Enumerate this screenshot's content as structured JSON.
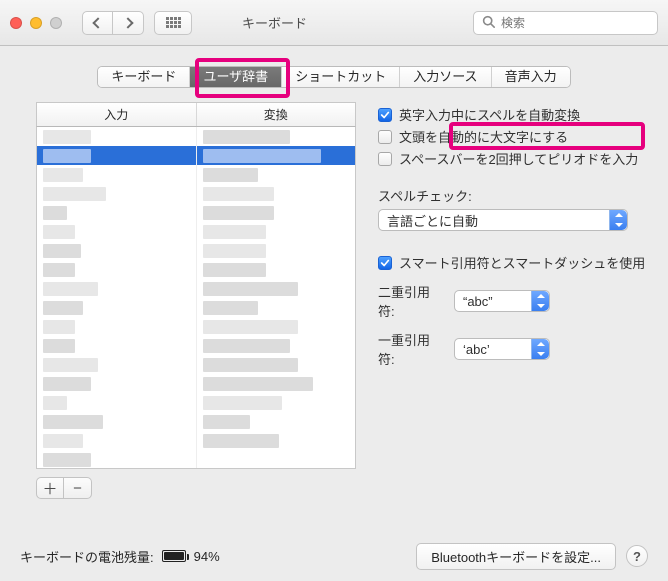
{
  "window": {
    "title": "キーボード"
  },
  "search": {
    "placeholder": "検索"
  },
  "tabs": {
    "items": [
      "キーボード",
      "ユーザ辞書",
      "ショートカット",
      "入力ソース",
      "音声入力"
    ],
    "active_index": 1
  },
  "table": {
    "columns": [
      "入力",
      "変換"
    ]
  },
  "buttons": {
    "add": "＋",
    "remove": "−"
  },
  "options": {
    "auto_convert_spelling": {
      "label": "英字入力中にスペルを自動変換",
      "checked": true
    },
    "capitalize_sentence": {
      "label": "文頭を自動的に大文字にする",
      "checked": false
    },
    "double_space_period": {
      "label": "スペースバーを2回押してピリオドを入力",
      "checked": false
    },
    "spellcheck_label": "スペルチェック:",
    "spellcheck_value": "言語ごとに自動",
    "smart_quotes": {
      "label": "スマート引用符とスマートダッシュを使用",
      "checked": true
    },
    "double_quote_label": "二重引用符:",
    "double_quote_value": "“abc”",
    "single_quote_label": "一重引用符:",
    "single_quote_value": "‘abc’"
  },
  "footer": {
    "battery_label": "キーボードの電池残量:",
    "battery_pct": "94%",
    "bluetooth_btn": "Bluetoothキーボードを設定...",
    "help": "?"
  }
}
